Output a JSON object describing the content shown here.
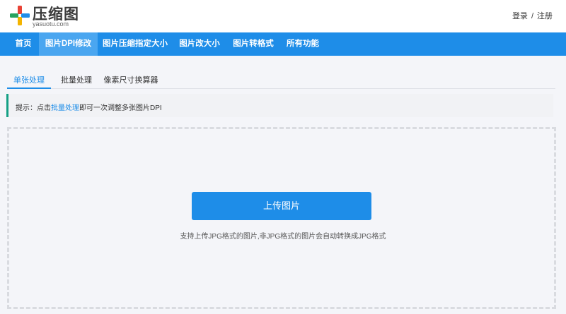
{
  "header": {
    "logo": {
      "title": "压缩图",
      "domain": "yasuotu.com",
      "colors": [
        "#e94235",
        "#1e8de8",
        "#27a35f",
        "#f4b400"
      ]
    },
    "auth": {
      "login": "登录",
      "separator": "/",
      "register": "注册"
    }
  },
  "nav": {
    "items": [
      {
        "label": "首页"
      },
      {
        "label": "图片DPI修改",
        "active": true
      },
      {
        "label": "图片压缩指定大小"
      },
      {
        "label": "图片改大小"
      },
      {
        "label": "图片转格式"
      },
      {
        "label": "所有功能"
      }
    ],
    "color": "#1e8de8",
    "active_color": "#4aa6f0"
  },
  "tabs": [
    {
      "label": "单张处理",
      "active": true
    },
    {
      "label": "批量处理"
    },
    {
      "label": "像素尺寸换算器"
    }
  ],
  "tip": {
    "prefix": "提示：点击",
    "link": "批量处理",
    "suffix": "即可一次调整多张图片DPI",
    "accent": "#14a085"
  },
  "upload": {
    "button_label": "上传图片",
    "note": "支持上传JPG格式的图片,非JPG格式的图片会自动转换成JPG格式"
  }
}
